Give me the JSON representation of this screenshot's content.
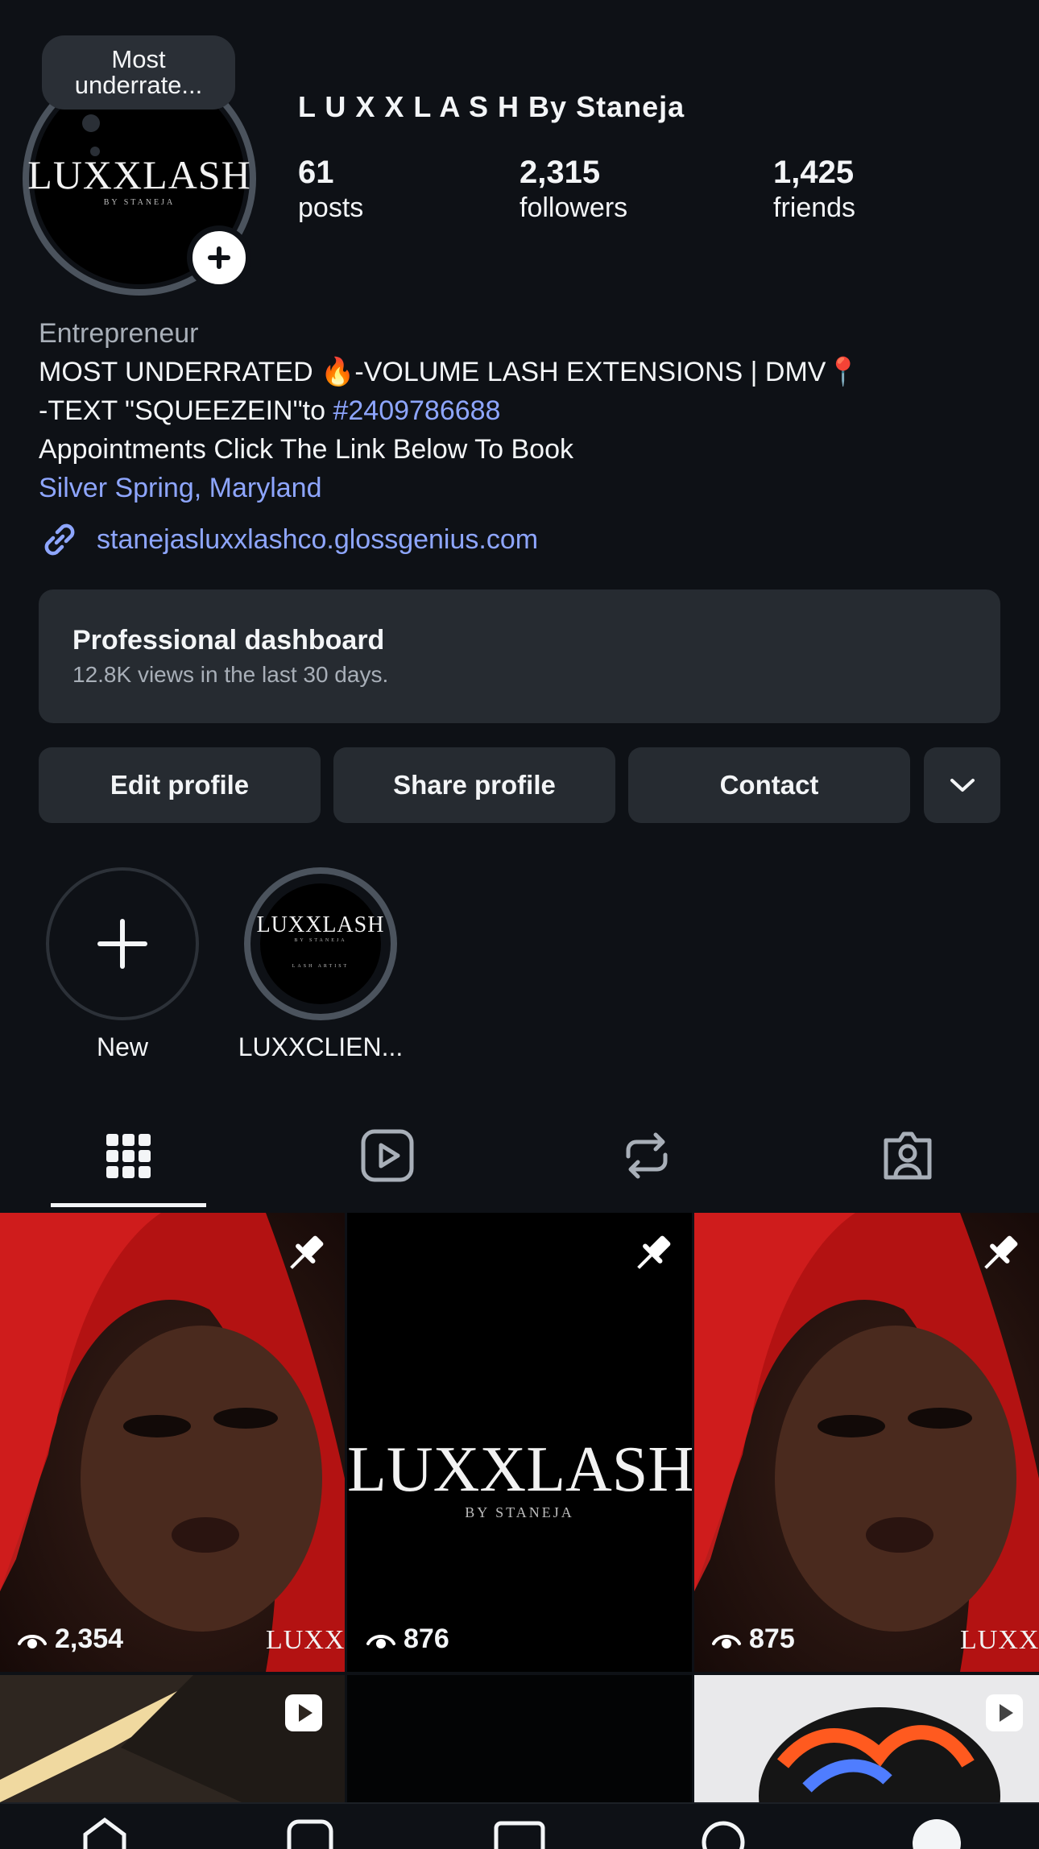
{
  "note": {
    "text": "Most underrate..."
  },
  "profile": {
    "username": "L U X X L A S H By Staneja",
    "avatar_logo": "LUXXLASH",
    "avatar_logo_sub": "BY STANEJA",
    "stats": [
      {
        "value": "61",
        "label": "posts"
      },
      {
        "value": "2,315",
        "label": "followers"
      },
      {
        "value": "1,425",
        "label": "friends"
      }
    ]
  },
  "bio": {
    "category": "Entrepreneur",
    "line1": "MOST UNDERRATED 🔥-VOLUME LASH EXTENSIONS | DMV📍",
    "line2_prefix": "-TEXT \"SQUEEZEIN\"to ",
    "line2_hashtag": "#2409786688",
    "line3": " Appointments Click The Link Below To Book",
    "location": "Silver Spring, Maryland",
    "link": "stanejasluxxlashco.glossgenius.com"
  },
  "dashboard": {
    "title": "Professional dashboard",
    "subtitle": "12.8K views in the last 30 days."
  },
  "actions": {
    "edit": "Edit profile",
    "share": "Share profile",
    "contact": "Contact"
  },
  "highlights": [
    {
      "label": "New"
    },
    {
      "label": "LUXXCLIEN...",
      "logo": "LUXXLASH",
      "logo_sub": "BY STANEJA",
      "caption": "LASH ARTIST"
    }
  ],
  "tabs": [
    "grid-icon",
    "reels-icon",
    "reposts-icon",
    "tagged-icon"
  ],
  "posts": [
    {
      "views": "2,354",
      "pinned": true,
      "watermark": "LUXXL"
    },
    {
      "views": "876",
      "pinned": true,
      "logo": "LUXXLASH",
      "logo_sub": "BY STANEJA"
    },
    {
      "views": "875",
      "pinned": true,
      "watermark": "LUXXL"
    }
  ]
}
